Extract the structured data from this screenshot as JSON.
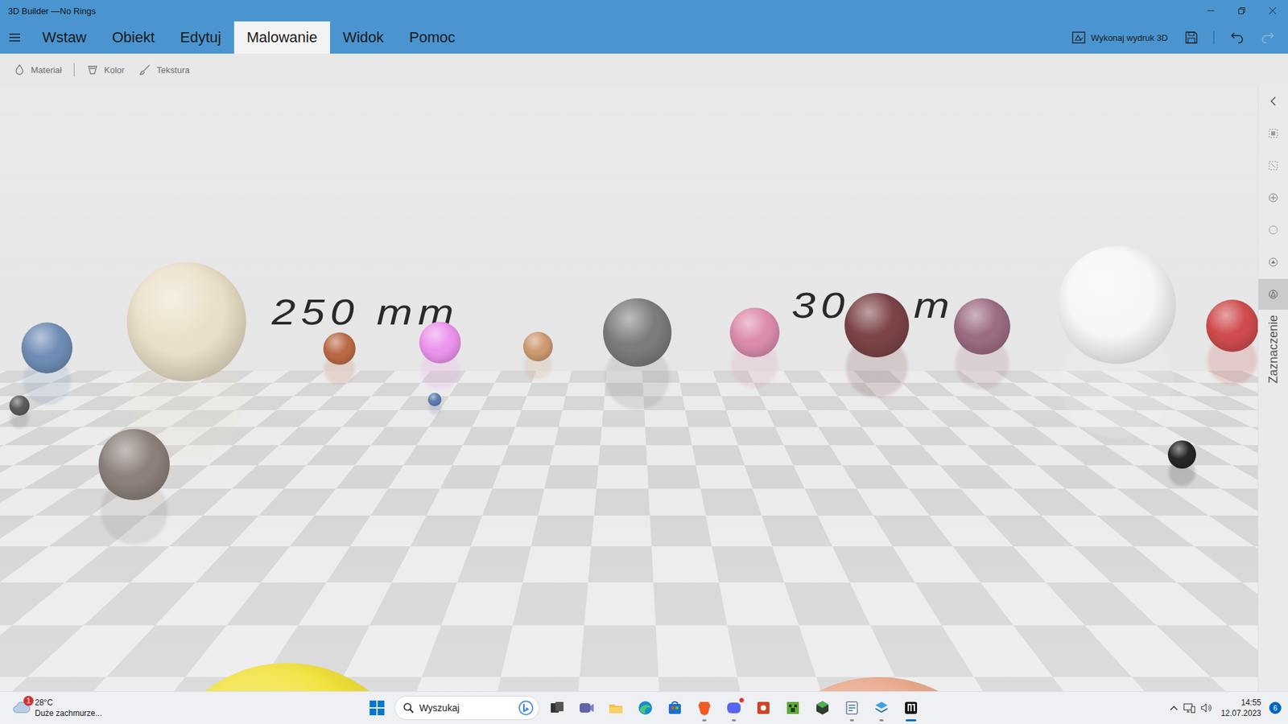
{
  "window": {
    "title": "3D Builder —No Rings"
  },
  "menu": {
    "tabs": [
      {
        "label": "Wstaw",
        "selected": false
      },
      {
        "label": "Obiekt",
        "selected": false
      },
      {
        "label": "Edytuj",
        "selected": false
      },
      {
        "label": "Malowanie",
        "selected": true
      },
      {
        "label": "Widok",
        "selected": false
      },
      {
        "label": "Pomoc",
        "selected": false
      }
    ],
    "print": "Wykonaj wydruk 3D",
    "undo_disabled": false,
    "redo_disabled": true
  },
  "toolbar": {
    "items": [
      {
        "label": "Materiał"
      },
      {
        "label": "Kolor"
      },
      {
        "label": "Tekstura"
      }
    ]
  },
  "scene": {
    "labels": [
      "250 mm",
      "30",
      "m"
    ],
    "spheres": [
      {
        "color": "#6f8db4"
      },
      {
        "color": "#eae0c8"
      },
      {
        "color": "#5a5a5a"
      },
      {
        "color": "#8c817a"
      },
      {
        "color": "#b96a45"
      },
      {
        "color": "#ec94ec"
      },
      {
        "color": "#5a7cb0"
      },
      {
        "color": "#cc9a70"
      },
      {
        "color": "#7c7c7c"
      },
      {
        "color": "#db8cac"
      },
      {
        "color": "#7c4447"
      },
      {
        "color": "#9c6c82"
      },
      {
        "color": "#f6f6f6"
      },
      {
        "color": "#cf4b4d"
      },
      {
        "color": "#262626"
      },
      {
        "color": "#f2e23a"
      },
      {
        "color": "#eaa98b"
      }
    ]
  },
  "side_panel": {
    "label": "Zaznaczenie",
    "tools": [
      {
        "selected": false
      },
      {
        "selected": false
      },
      {
        "selected": false
      },
      {
        "selected": false
      },
      {
        "selected": false
      },
      {
        "selected": true
      }
    ]
  },
  "taskbar": {
    "weather": {
      "temperature": "28°C",
      "condition": "Duże zachmurze...",
      "badge": "1"
    },
    "search": {
      "placeholder": "Wyszukaj"
    },
    "apps": [
      {
        "running": false,
        "active": false,
        "badge": false
      },
      {
        "running": false,
        "active": false,
        "badge": false
      },
      {
        "running": false,
        "active": false,
        "badge": false
      },
      {
        "running": false,
        "active": false,
        "badge": false
      },
      {
        "running": false,
        "active": false,
        "badge": false
      },
      {
        "running": true,
        "active": false,
        "badge": false
      },
      {
        "running": true,
        "active": false,
        "badge": true
      },
      {
        "running": false,
        "active": false,
        "badge": false
      },
      {
        "running": false,
        "active": false,
        "badge": false
      },
      {
        "running": false,
        "active": false,
        "badge": false
      },
      {
        "running": true,
        "active": false,
        "badge": false
      },
      {
        "running": true,
        "active": false,
        "badge": false
      },
      {
        "running": true,
        "active": true,
        "badge": false
      }
    ],
    "clock": {
      "time": "14:55",
      "date": "12.07.2023"
    },
    "notifications": "6"
  }
}
